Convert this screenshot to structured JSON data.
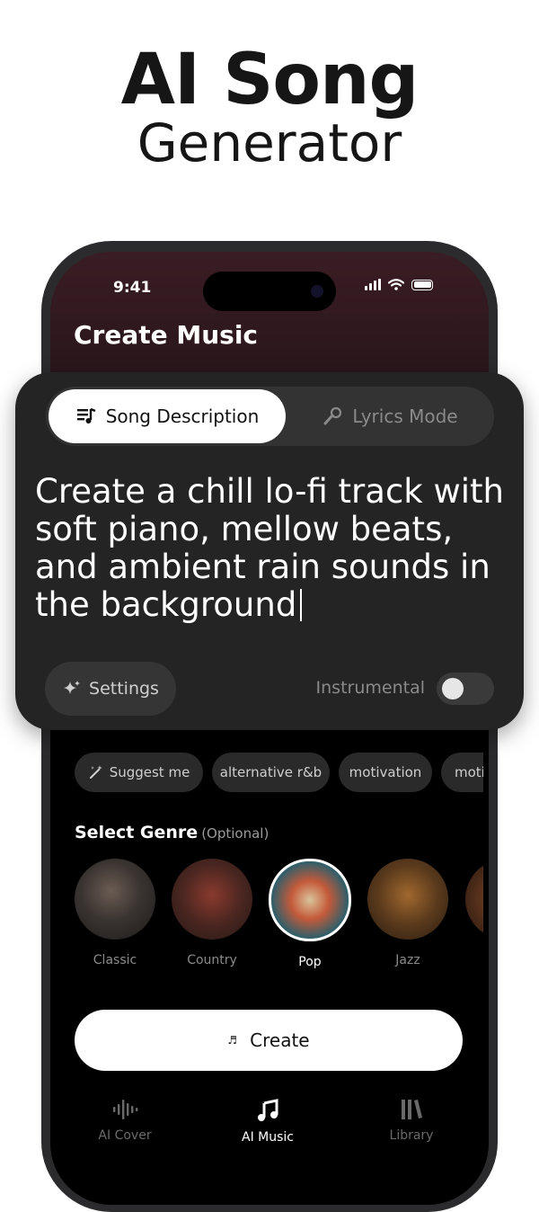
{
  "hero": {
    "title": "AI Song",
    "subtitle": "Generator"
  },
  "status_bar": {
    "time": "9:41"
  },
  "header": {
    "title": "Create Music"
  },
  "mode_tabs": {
    "song_description": "Song Description",
    "lyrics_mode": "Lyrics Mode",
    "active": "song_description"
  },
  "prompt": {
    "text": "Create a chill lo-fi track with soft piano, mellow beats, and ambient rain sounds in the background"
  },
  "settings": {
    "label": "Settings"
  },
  "instrumental": {
    "label": "Instrumental",
    "enabled": false
  },
  "suggestions": [
    "Suggest me",
    "alternative r&b",
    "motivation",
    "moti"
  ],
  "genre_section": {
    "title": "Select Genre",
    "optional": "(Optional)"
  },
  "genres": [
    {
      "name": "Classic",
      "selected": false
    },
    {
      "name": "Country",
      "selected": false
    },
    {
      "name": "Pop",
      "selected": true
    },
    {
      "name": "Jazz",
      "selected": false
    },
    {
      "name": "",
      "selected": false
    }
  ],
  "create_button": {
    "label": "Create",
    "icon": "music-note-icon"
  },
  "bottom_nav": [
    {
      "label": "AI Cover",
      "icon": "waveform-icon",
      "active": false
    },
    {
      "label": "AI Music",
      "icon": "music-note-icon",
      "active": true
    },
    {
      "label": "Library",
      "icon": "library-icon",
      "active": false
    }
  ],
  "colors": {
    "accent": "#ffffff",
    "card": "#242424",
    "background": "#000000",
    "muted": "#8a8a8a"
  }
}
